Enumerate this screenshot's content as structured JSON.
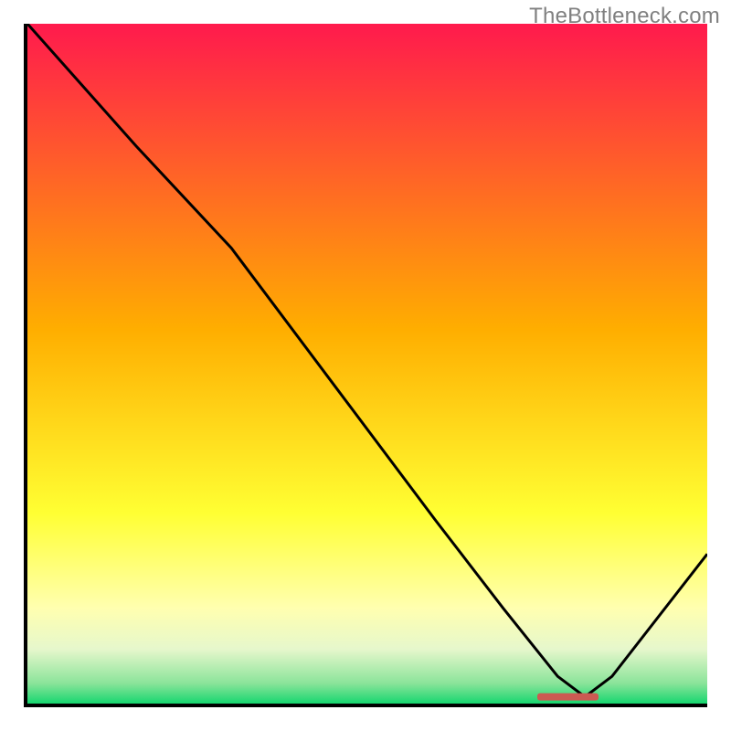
{
  "watermark": "TheBottleneck.com",
  "colors": {
    "gradient_top": "#ff1a4d",
    "gradient_mid": "#ffae00",
    "gradient_low": "#ffff66",
    "gradient_paleyellow": "#ffffcc",
    "gradient_palegreen": "#d8f6c8",
    "gradient_green": "#17d66f",
    "curve": "#000000",
    "marker": "#cc5a52",
    "axis": "#000000",
    "watermark": "#808080"
  },
  "chart_data": {
    "type": "line",
    "title": "",
    "xlabel": "",
    "ylabel": "",
    "xlim": [
      0,
      100
    ],
    "ylim": [
      0,
      100
    ],
    "series": [
      {
        "name": "curve",
        "x": [
          0,
          16,
          30,
          45,
          60,
          70,
          78,
          82,
          86,
          100
        ],
        "y": [
          100,
          82,
          67,
          47,
          27,
          14,
          4,
          1,
          4,
          22
        ]
      }
    ],
    "marker": {
      "x_start": 75,
      "x_end": 84,
      "y": 1
    },
    "gradient_stops": [
      {
        "offset": 0.0,
        "color": "#ff1a4d"
      },
      {
        "offset": 0.45,
        "color": "#ffae00"
      },
      {
        "offset": 0.72,
        "color": "#ffff33"
      },
      {
        "offset": 0.86,
        "color": "#ffffb0"
      },
      {
        "offset": 0.92,
        "color": "#e6f7cc"
      },
      {
        "offset": 0.97,
        "color": "#8be49a"
      },
      {
        "offset": 1.0,
        "color": "#17d66f"
      }
    ]
  }
}
